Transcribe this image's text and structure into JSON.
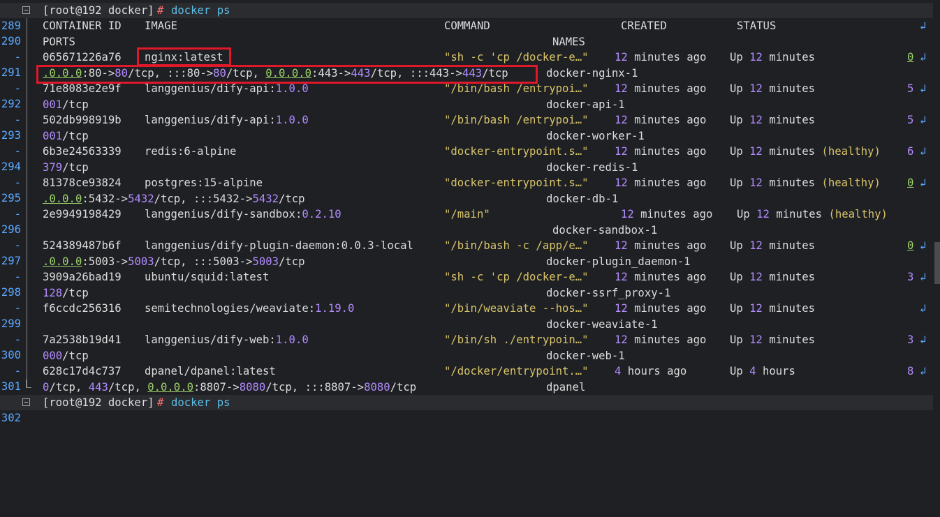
{
  "colors": {
    "background": "#1e2024",
    "highlight": "#e0182a"
  },
  "prompt": {
    "user_host": "[root@192 docker]",
    "hash": "#",
    "command": "docker ps"
  },
  "lines": {
    "l289": "289",
    "l290": "290",
    "l291": "291",
    "l292": "292",
    "l293": "293",
    "l294": "294",
    "l295": "295",
    "l296": "296",
    "l297": "297",
    "l298": "298",
    "l299": "299",
    "l300": "300",
    "l301": "301",
    "l302": "302",
    "dash": "-"
  },
  "header": {
    "container_id": "CONTAINER ID",
    "image": "IMAGE",
    "command": "COMMAND",
    "created": "CREATED",
    "status": "STATUS",
    "ports": "PORTS",
    "names": "NAMES"
  },
  "wrap_glyph": "↲",
  "containers": [
    {
      "id": "065671226a76",
      "image_a": "nginx",
      "image_b": ":",
      "image_c": "latest",
      "command": "\"sh -c 'cp /docker-e…\"",
      "created_n": "12",
      "created_t": " minutes ago",
      "status_a": "Up ",
      "status_n": "12",
      "status_t": " minutes",
      "tail": "0",
      "ports": ".0.0.0:80->80/tcp, :::80->80/tcp, 0.0.0.0:443->443/tcp, :::443->443/tcp",
      "name": "docker-nginx-1"
    },
    {
      "id": "71e8083e2e9f",
      "image_a": "langgenius/dify-api",
      "image_b": ":",
      "image_c": "1.0.0",
      "command": "\"/bin/bash /entrypoi…\"",
      "created_n": "12",
      "created_t": " minutes ago",
      "status_a": "Up ",
      "status_n": "12",
      "status_t": " minutes",
      "tail": "5",
      "ports_n": "001",
      "ports_t": "/tcp",
      "name": "docker-api-1"
    },
    {
      "id": "502db998919b",
      "image_a": "langgenius/dify-api",
      "image_b": ":",
      "image_c": "1.0.0",
      "command": "\"/bin/bash /entrypoi…\"",
      "created_n": "12",
      "created_t": " minutes ago",
      "status_a": "Up ",
      "status_n": "12",
      "status_t": " minutes",
      "tail": "5",
      "ports_n": "001",
      "ports_t": "/tcp",
      "name": "docker-worker-1"
    },
    {
      "id": "6b3e24563339",
      "image_a": "redis",
      "image_b": ":",
      "image_c": "6-alpine",
      "command": "\"docker-entrypoint.s…\"",
      "created_n": "12",
      "created_t": " minutes ago",
      "status_a": "Up ",
      "status_n": "12",
      "status_t": " minutes ",
      "health": "(healthy)",
      "tail": "6",
      "ports_n": "379",
      "ports_t": "/tcp",
      "name": "docker-redis-1"
    },
    {
      "id": "81378ce93824",
      "image_a": "postgres",
      "image_b": ":",
      "image_c": "15-alpine",
      "command": "\"docker-entrypoint.s…\"",
      "created_n": "12",
      "created_t": " minutes ago",
      "status_a": "Up ",
      "status_n": "12",
      "status_t": " minutes ",
      "health": "(healthy)",
      "tail": "0",
      "ports": ".0.0.0:5432->5432/tcp, :::5432->5432/tcp",
      "name": "docker-db-1"
    },
    {
      "id": "2e9949198429",
      "image_a": "langgenius/dify-sandbox",
      "image_b": ":",
      "image_c": "0.2.10",
      "command": "\"/main\"",
      "created_n": "12",
      "created_t": " minutes ago",
      "status_a": "Up ",
      "status_n": "12",
      "status_t": " minutes ",
      "health": "(healthy)",
      "name": "docker-sandbox-1"
    },
    {
      "id": "524389487b6f",
      "image_a": "langgenius/dify-plugin-daemon",
      "image_b": ":",
      "image_c": "0.0.3-local",
      "command": "\"/bin/bash -c /app/e…\"",
      "created_n": "12",
      "created_t": " minutes ago",
      "status_a": "Up ",
      "status_n": "12",
      "status_t": " minutes",
      "tail": "0",
      "ports": ".0.0.0:5003->5003/tcp, :::5003->5003/tcp",
      "name": "docker-plugin_daemon-1"
    },
    {
      "id": "3909a26bad19",
      "image_a": "ubuntu/squid",
      "image_b": ":",
      "image_c": "latest",
      "command": "\"sh -c 'cp /docker-e…\"",
      "created_n": "12",
      "created_t": " minutes ago",
      "status_a": "Up ",
      "status_n": "12",
      "status_t": " minutes",
      "tail": "3",
      "ports_n": "128",
      "ports_t": "/tcp",
      "name": "docker-ssrf_proxy-1"
    },
    {
      "id": "f6ccdc256316",
      "image_a": "semitechnologies/weaviate",
      "image_b": ":",
      "image_c": "1.19.0",
      "command": "\"/bin/weaviate --hos…\"",
      "created_n": "12",
      "created_t": " minutes ago",
      "status_a": "Up ",
      "status_n": "12",
      "status_t": " minutes",
      "name": "docker-weaviate-1"
    },
    {
      "id": "7a2538b19d41",
      "image_a": "langgenius/dify-web",
      "image_b": ":",
      "image_c": "1.0.0",
      "command": "\"/bin/sh ./entrypoin…\"",
      "created_n": "12",
      "created_t": " minutes ago",
      "status_a": "Up ",
      "status_n": "12",
      "status_t": " minutes",
      "tail": "3",
      "ports_n": "000",
      "ports_t": "/tcp",
      "name": "docker-web-1"
    },
    {
      "id": "628c17d4c737",
      "image_a": "dpanel/dpanel",
      "image_b": ":",
      "image_c": "latest",
      "command": "\"/docker/entrypoint.…\"",
      "created_n": "4",
      "created_t": " hours ago",
      "status_a": "Up ",
      "status_n": "4",
      "status_t": " hours",
      "tail": "8",
      "ports": "0/tcp, 443/tcp, 0.0.0.0:8807->8080/tcp, :::8807->8080/tcp",
      "name": "dpanel"
    }
  ]
}
